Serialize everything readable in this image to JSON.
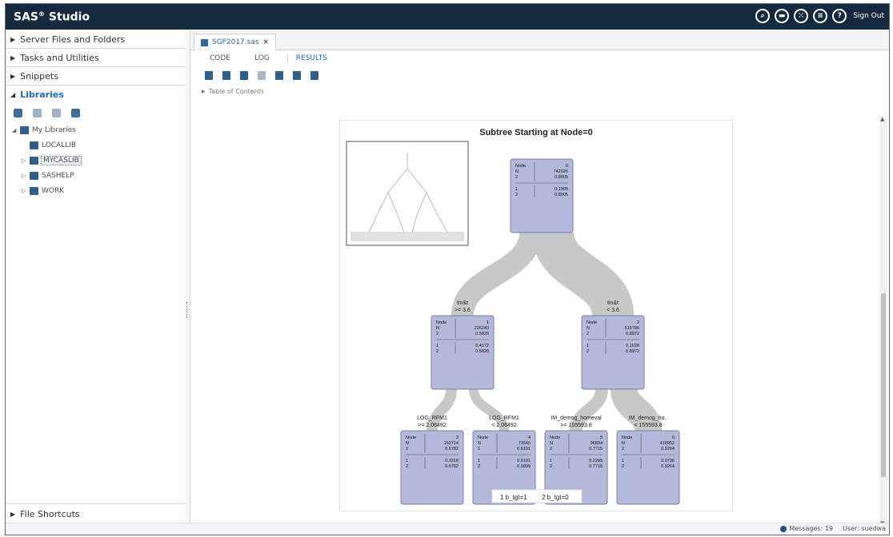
{
  "app": {
    "title": "SAS",
    "title_mark": "®",
    "title_suffix": "Studio"
  },
  "topbar": {
    "icons": [
      "search-icon",
      "folder-open-icon",
      "apps-grid-icon",
      "menu-list-icon",
      "help-icon"
    ],
    "help_glyph": "?",
    "sign_out": "Sign Out"
  },
  "sidebar": {
    "sections": [
      {
        "label": "Server Files and Folders",
        "expanded": false
      },
      {
        "label": "Tasks and Utilities",
        "expanded": false
      },
      {
        "label": "Snippets",
        "expanded": false
      },
      {
        "label": "Libraries",
        "expanded": true
      }
    ],
    "library_toolbar_icons": [
      "new-library-icon",
      "delete-icon",
      "properties-icon",
      "refresh-icon"
    ],
    "tree": [
      {
        "label": "My Libraries",
        "level": 0,
        "expanded": true
      },
      {
        "label": "LOCALLIB",
        "level": 1
      },
      {
        "label": "MYCASLIB",
        "level": 1,
        "selected": true
      },
      {
        "label": "SASHELP",
        "level": 1
      },
      {
        "label": "WORK",
        "level": 1
      }
    ],
    "bottom": "File Shortcuts"
  },
  "editor": {
    "file_tab": "SGF2017.sas",
    "close_glyph": "×",
    "tabs": [
      "CODE",
      "LOG",
      "RESULTS"
    ],
    "active_tab": "RESULTS",
    "toolbar_icons": [
      "html-icon",
      "pdf-icon",
      "rtf-icon",
      "download-icon",
      "print-icon",
      "open-in-new-icon",
      "maximize-icon"
    ],
    "toc": "Table of Contents"
  },
  "status": {
    "messages": "Messages: 19",
    "user": "User: suedwa"
  },
  "chart_data": {
    "type": "tree",
    "title": "Subtree Starting at Node=0",
    "nodes": [
      {
        "id": 0,
        "node_label": "Node",
        "node_value": "0",
        "n_label": "N",
        "n_value": "742026",
        "pred_label": "2",
        "pred_value": "0.8005",
        "rows": [
          [
            "1",
            "0.1995"
          ],
          [
            "2",
            "0.8005"
          ]
        ]
      },
      {
        "id": 1,
        "split_var": "tin&t",
        "split_rule": ">= 3.6",
        "node_label": "Node",
        "node_value": "1",
        "n_label": "N",
        "n_value": "226240",
        "pred_label": "2",
        "pred_value": "0.5828",
        "rows": [
          [
            "1",
            "0.4172"
          ],
          [
            "2",
            "0.5828"
          ]
        ]
      },
      {
        "id": 2,
        "split_var": "tin&t",
        "split_rule": "< 3.6",
        "node_label": "Node",
        "node_value": "2",
        "n_label": "N",
        "n_value": "515786",
        "pred_label": "2",
        "pred_value": "0.8972",
        "rows": [
          [
            "1",
            "0.1028"
          ],
          [
            "2",
            "0.8972"
          ]
        ]
      },
      {
        "id": 3,
        "split_var": "LOG_RFM1",
        "split_rule": ">= 2.06492",
        "node_label": "Node",
        "node_value": "3",
        "n_label": "N",
        "n_value": "152714",
        "pred_label": "2",
        "pred_value": "0.6782",
        "rows": [
          [
            "1",
            "0.3218"
          ],
          [
            "2",
            "0.6782"
          ]
        ]
      },
      {
        "id": 4,
        "split_var": "LOG_RFM1",
        "split_rule": "< 2.06492",
        "node_label": "Node",
        "node_value": "4",
        "n_label": "N",
        "n_value": "73546",
        "pred_label": "1",
        "pred_value": "0.6101",
        "rows": [
          [
            "1",
            "0.6101"
          ],
          [
            "2",
            "0.3899"
          ]
        ]
      },
      {
        "id": 5,
        "split_var": "IM_demog_homeval",
        "split_rule": ">= 155593.8",
        "node_label": "Node",
        "node_value": "5",
        "n_label": "N",
        "n_value": "96834",
        "pred_label": "2",
        "pred_value": "0.7715",
        "rows": [
          [
            "1",
            "0.2285"
          ],
          [
            "2",
            "0.7715"
          ]
        ]
      },
      {
        "id": 6,
        "split_var": "IM_demog_ho..",
        "split_rule": "< 155593.8",
        "node_label": "Node",
        "node_value": "6",
        "n_label": "N",
        "n_value": "418952",
        "pred_label": "2",
        "pred_value": "0.9264",
        "rows": [
          [
            "1",
            "0.0736"
          ],
          [
            "2",
            "0.9264"
          ]
        ]
      }
    ],
    "edges": [
      [
        0,
        1
      ],
      [
        0,
        2
      ],
      [
        1,
        3
      ],
      [
        1,
        4
      ],
      [
        2,
        5
      ],
      [
        2,
        6
      ]
    ],
    "legend": [
      "1  b_tgt=1",
      "2  b_tgt=0"
    ],
    "colors": {
      "node_fill": "#b4b9dc",
      "node_stroke": "#7a7fa8",
      "ribbon": "#c8c8c8"
    }
  }
}
